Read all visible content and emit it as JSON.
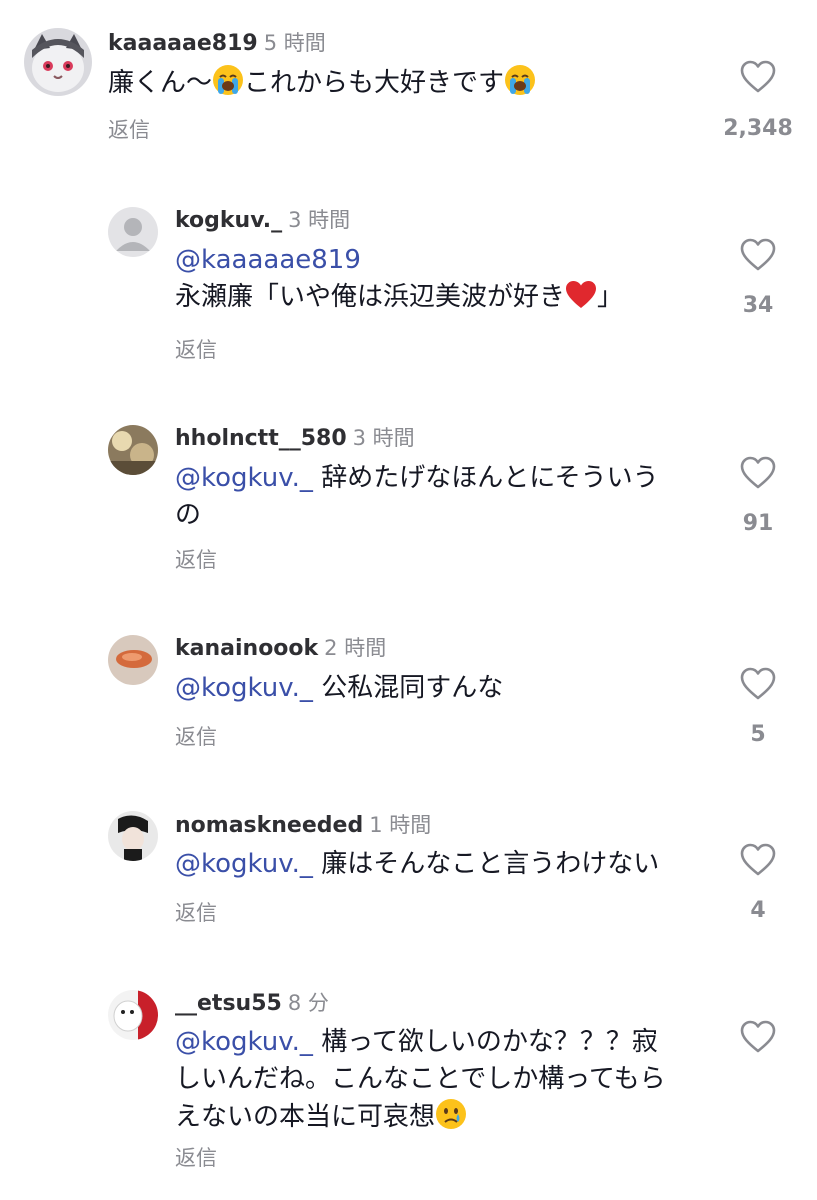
{
  "comments": [
    {
      "username": "kaaaaae819",
      "time": "5 時間",
      "text_a": "廉くん〜",
      "text_b": "これからも大好きです",
      "reply": "返信",
      "likes": "2,348",
      "emoji": "loudly-crying-face"
    },
    {
      "username": "kogkuv._",
      "time": "3 時間",
      "mention": "@kaaaaae819",
      "text_a": "永瀬廉「いや俺は浜辺美波が好き",
      "text_b": "」",
      "reply": "返信",
      "likes": "34",
      "emoji": "red-heart"
    },
    {
      "username": "hholnctt__580",
      "time": "3 時間",
      "mention": "@kogkuv._",
      "text_line1": "辞めたげなほんとにそういう",
      "text_line2": "の",
      "reply": "返信",
      "likes": "91"
    },
    {
      "username": "kanainoook",
      "time": "2 時間",
      "mention": "@kogkuv._",
      "text": "公私混同すんな",
      "reply": "返信",
      "likes": "5"
    },
    {
      "username": "nomaskneeded",
      "time": "1 時間",
      "mention": "@kogkuv._",
      "text": "廉はそんなこと言うわけない",
      "reply": "返信",
      "likes": "4"
    },
    {
      "username": "__etsu55",
      "time": "8 分",
      "mention": "@kogkuv._",
      "text_line1": "構って欲しいのかな？？？寂",
      "text_line2": "しいんだね。こんなことでしか構ってもら",
      "text_line3": "えないの本当に可哀想",
      "reply": "返信",
      "emoji": "crying-face"
    }
  ],
  "colors": {
    "username": "#2f2f33",
    "secondary": "#8a8b91",
    "mention": "#3a4fa8",
    "text": "#161823"
  }
}
